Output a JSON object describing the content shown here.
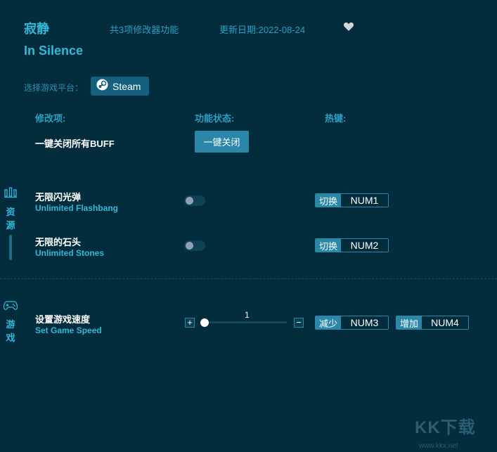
{
  "header": {
    "title_cn": "寂静",
    "title_en": "In Silence",
    "feature_count": "共3项修改器功能",
    "update_date": "更新日期:2022-08-24"
  },
  "platform": {
    "label": "选择游戏平台：",
    "steam_label": "Steam"
  },
  "columns": {
    "mod": "修改项:",
    "status": "功能状态:",
    "hotkey": "热键:"
  },
  "onekey": {
    "label": "一键关闭所有BUFF",
    "button": "一键关闭"
  },
  "sidebar": {
    "resources": "资源",
    "game": "游戏"
  },
  "rows": [
    {
      "cn": "无限闪光弹",
      "en": "Unlimited Flashbang",
      "on": false,
      "key_action": "切换",
      "key": "NUM1"
    },
    {
      "cn": "无限的石头",
      "en": "Unlimited Stones",
      "on": false,
      "key_action": "切换",
      "key": "NUM2"
    }
  ],
  "speed": {
    "cn": "设置游戏速度",
    "en": "Set Game Speed",
    "value": "1",
    "plus": "+",
    "minus": "−",
    "dec_action": "减少",
    "dec_key": "NUM3",
    "inc_action": "增加",
    "inc_key": "NUM4"
  },
  "watermark": {
    "logo": "KK下载",
    "url": "www.kkx.net"
  },
  "colors": {
    "background": "#032c3c",
    "accent": "#35b8dc",
    "button": "#2b87a8"
  }
}
